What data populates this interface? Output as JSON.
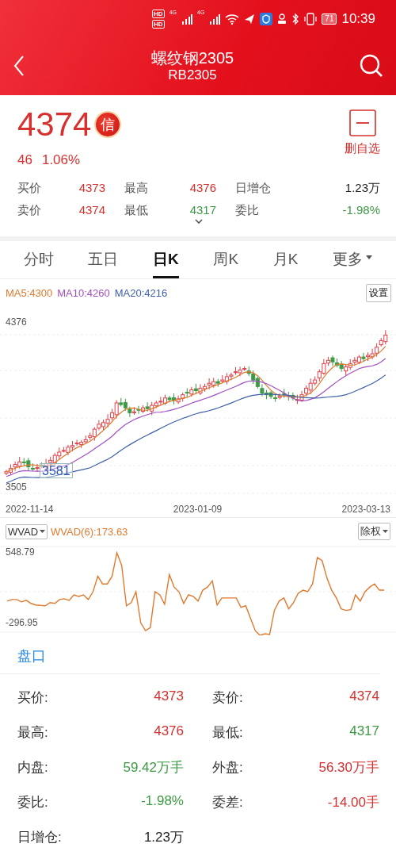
{
  "status_bar": {
    "sim_labels": [
      "HD",
      "HD"
    ],
    "network_labels": [
      "4G",
      "4G"
    ],
    "battery": "71",
    "time": "10:39"
  },
  "header": {
    "title": "螺纹钢2305",
    "subtitle": "RB2305"
  },
  "quote": {
    "price": "4374",
    "badge": "信",
    "change": "46",
    "change_percent": "1.06%",
    "watch_button": "删自选",
    "stats": [
      {
        "label": "买价",
        "value": "4373",
        "color": "#d6302f"
      },
      {
        "label": "最高",
        "value": "4376",
        "color": "#d6302f"
      },
      {
        "label": "日增仓",
        "value": "1.23万",
        "color": "#222222"
      },
      {
        "label": "卖价",
        "value": "4374",
        "color": "#d6302f"
      },
      {
        "label": "最低",
        "value": "4317",
        "color": "#3d9a45"
      },
      {
        "label": "委比",
        "value": "-1.98%",
        "color": "#3d9a45"
      }
    ]
  },
  "tabs": [
    {
      "label": "分时",
      "selected": false
    },
    {
      "label": "五日",
      "selected": false
    },
    {
      "label": "日K",
      "selected": true
    },
    {
      "label": "周K",
      "selected": false
    },
    {
      "label": "月K",
      "selected": false
    },
    {
      "label": "更多",
      "selected": false,
      "dropdown": true
    }
  ],
  "kline": {
    "ma": [
      {
        "text": "MA5:4300",
        "color": "#e07a2e"
      },
      {
        "text": "MA10:4260",
        "color": "#a150c0"
      },
      {
        "text": "MA20:4216",
        "color": "#3d5fa8"
      }
    ],
    "settings_button": "设置",
    "high_label": "4376",
    "low_label": "3505",
    "marker_label": "3581",
    "dates": [
      "2022-11-14",
      "2023-01-09",
      "2023-03-13"
    ]
  },
  "indicator": {
    "selector": "WVAD",
    "value": "WVAD(6):173.63",
    "adjust_button": "除权",
    "max_label": "548.79",
    "min_label": "-296.95"
  },
  "handicap": {
    "title": "盘口",
    "rows": [
      [
        {
          "label": "买价:",
          "value": "4373",
          "color": "#d6302f"
        },
        {
          "label": "卖价:",
          "value": "4374",
          "color": "#d6302f"
        }
      ],
      [
        {
          "label": "最高:",
          "value": "4376",
          "color": "#d6302f"
        },
        {
          "label": "最低:",
          "value": "4317",
          "color": "#3d9a45"
        }
      ],
      [
        {
          "label": "内盘:",
          "value": "59.42万手",
          "color": "#3d9a45"
        },
        {
          "label": "外盘:",
          "value": "56.30万手",
          "color": "#d6302f"
        }
      ],
      [
        {
          "label": "委比:",
          "value": "-1.98%",
          "color": "#3d9a45"
        },
        {
          "label": "委差:",
          "value": "-14.00手",
          "color": "#d6302f"
        }
      ],
      [
        {
          "label": "日增仓:",
          "value": "1.23万",
          "color": "#222222"
        }
      ]
    ]
  }
}
